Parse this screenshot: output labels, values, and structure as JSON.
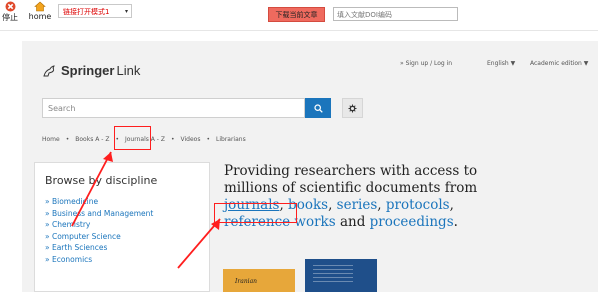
{
  "toolbar": {
    "stop_label": "停止",
    "home_label": "home",
    "mode_select_value": "链接打开模式1",
    "download_label": "下载当前文章",
    "doi_placeholder": "填入文献DOI编码"
  },
  "site": {
    "logo_prefix": "Springer",
    "logo_suffix": "Link",
    "signup": "» Sign up / Log in",
    "language": "English ▼",
    "edition": "Academic edition ▼",
    "search_placeholder": "Search"
  },
  "nav": {
    "items": [
      "Home",
      "Books A - Z",
      "Journals A - Z",
      "Videos",
      "Librarians"
    ]
  },
  "browse": {
    "title": "Browse by discipline",
    "items": [
      "» Biomedicine",
      "» Business and Management",
      "» Chemistry",
      "» Computer Science",
      "» Earth Sciences",
      "» Economics"
    ]
  },
  "hero": {
    "line1": "Providing researchers with access to",
    "line2": "millions of scientific documents from",
    "journals": "journals",
    "books": "books",
    "series": "series",
    "protocols": "protocols",
    "reference_works": "reference works",
    "and": "and",
    "proceedings": "proceedings"
  },
  "books": {
    "book1_title": "Iranian"
  },
  "colors": {
    "accent": "#1b75bc",
    "annotation": "#ff1e1e",
    "download_button": "#ef6a5e"
  }
}
